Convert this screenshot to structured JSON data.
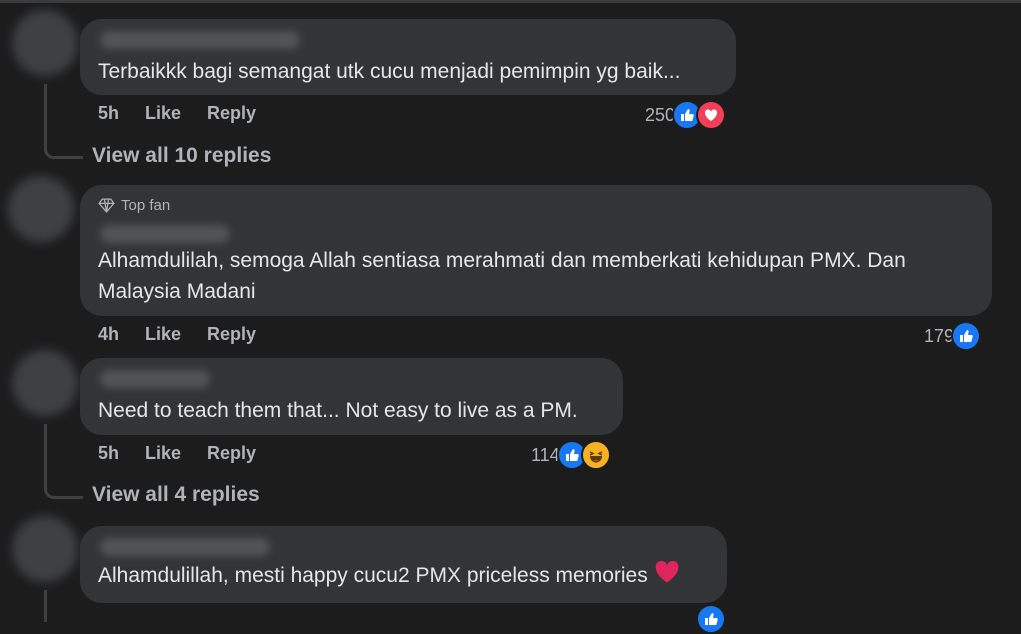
{
  "comments": [
    {
      "badge": "",
      "text_lines": [
        "Terbaikkk bagi semangat utk cucu menjadi pemimpin yg baik..."
      ],
      "time": "5h",
      "like_label": "Like",
      "reply_label": "Reply",
      "reaction_count": "250",
      "reactions": [
        "like",
        "love"
      ],
      "view_replies": "View all 10 replies"
    },
    {
      "badge": "Top fan",
      "text_lines": [
        "Alhamdulilah, semoga Allah sentiasa merahmati dan memberkati kehidupan PMX. Dan",
        "Malaysia Madani"
      ],
      "time": "4h",
      "like_label": "Like",
      "reply_label": "Reply",
      "reaction_count": "179",
      "reactions": [
        "like"
      ],
      "view_replies": ""
    },
    {
      "badge": "",
      "text_lines": [
        "Need to teach them that... Not easy to live as a PM."
      ],
      "time": "5h",
      "like_label": "Like",
      "reply_label": "Reply",
      "reaction_count": "114",
      "reactions": [
        "like",
        "haha"
      ],
      "view_replies": "View all 4 replies"
    },
    {
      "badge": "",
      "text_lines": [
        "Alhamdulillah, mesti happy cucu2 PMX priceless memories"
      ],
      "time": "",
      "like_label": "",
      "reply_label": "",
      "reaction_count": "",
      "reactions": [
        "like"
      ],
      "view_replies": ""
    }
  ],
  "colors": {
    "background": "#1c1c1d",
    "bubble": "#333436",
    "like": "#1877f2",
    "love": "#f33e58",
    "haha": "#f7b125"
  },
  "icons": {
    "top_fan": "diamond-icon",
    "like": "thumbs-up-icon",
    "love": "heart-icon",
    "haha": "laughing-face-icon",
    "inline_emoji": "red-heart-emoji"
  }
}
